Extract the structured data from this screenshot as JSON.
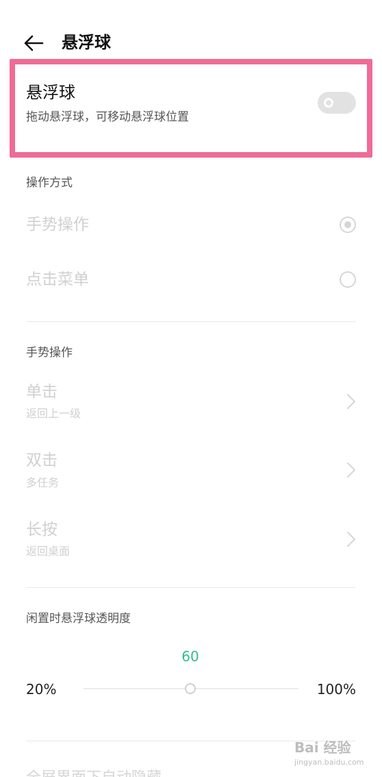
{
  "header": {
    "title": "悬浮球"
  },
  "master": {
    "title": "悬浮球",
    "subtitle": "拖动悬浮球，可移动悬浮球位置",
    "enabled": false
  },
  "operation_mode": {
    "header": "操作方式",
    "options": [
      {
        "label": "手势操作",
        "selected": true
      },
      {
        "label": "点击菜单",
        "selected": false
      }
    ]
  },
  "gestures": {
    "header": "手势操作",
    "items": [
      {
        "title": "单击",
        "subtitle": "返回上一级"
      },
      {
        "title": "双击",
        "subtitle": "多任务"
      },
      {
        "title": "长按",
        "subtitle": "返回桌面"
      }
    ]
  },
  "opacity": {
    "header": "闲置时悬浮球透明度",
    "value": "60",
    "min_label": "20%",
    "max_label": "100%",
    "value_fraction": 0.5
  },
  "cut_row": {
    "label": "全屏界面下自动隐藏"
  },
  "watermark": {
    "logo": "Bai 经验",
    "url": "jingyan.baidu.com"
  },
  "colors": {
    "highlight": "#f06b95",
    "accent": "#2fbe86",
    "disabled": "#d0d0d0"
  }
}
